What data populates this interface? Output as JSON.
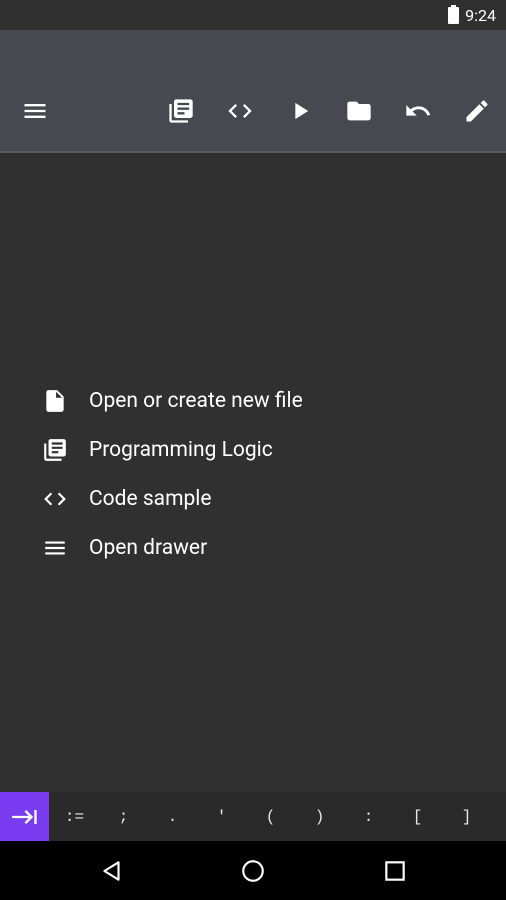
{
  "status": {
    "time": "9:24",
    "icons": [
      "battery-icon"
    ]
  },
  "toolbar": {
    "icons": [
      "menu-icon",
      "library-icon",
      "code-icon",
      "run-icon",
      "folder-icon",
      "undo-icon",
      "edit-icon"
    ]
  },
  "menu": {
    "items": [
      {
        "label": "Open or create new file",
        "icon": "file-icon"
      },
      {
        "label": "Programming Logic",
        "icon": "library-icon"
      },
      {
        "label": "Code sample",
        "icon": "code-icon"
      },
      {
        "label": "Open drawer",
        "icon": "menu-icon"
      }
    ]
  },
  "symbols": {
    "tab_icon": "tab-icon",
    "keys": [
      ":=",
      ";",
      ".",
      "'",
      "(",
      ")",
      ":",
      "[",
      "]"
    ]
  },
  "navigation": {
    "icons": [
      "back-icon",
      "home-icon",
      "recents-icon"
    ]
  },
  "colors": {
    "background": "#303030",
    "toolbar": "#474850",
    "accent": "#7a3cf0",
    "symbar": "#2a2a2a",
    "navbar": "#000000"
  }
}
